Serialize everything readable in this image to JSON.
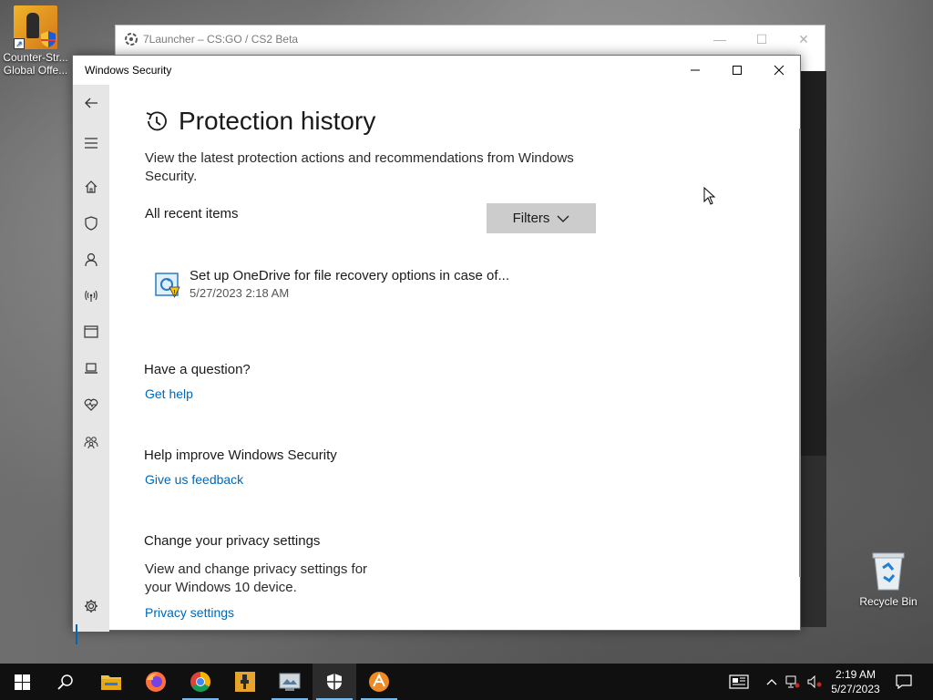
{
  "desktop": {
    "icons": [
      {
        "label": "Counter-Str... Global Offe..."
      },
      {
        "label": "Recycle Bin"
      }
    ]
  },
  "background_window": {
    "title": "7Launcher – CS:GO / CS2 Beta"
  },
  "window": {
    "title": "Windows Security",
    "controls": {
      "minimize": "minimize",
      "maximize": "maximize",
      "close": "close"
    }
  },
  "sidebar": {
    "items": [
      {
        "name": "back",
        "icon": "back-arrow-icon"
      },
      {
        "name": "menu",
        "icon": "hamburger-icon"
      },
      {
        "name": "home",
        "icon": "home-icon"
      },
      {
        "name": "virus-protection",
        "icon": "shield-icon"
      },
      {
        "name": "account-protection",
        "icon": "person-icon"
      },
      {
        "name": "firewall",
        "icon": "antenna-icon"
      },
      {
        "name": "app-browser-control",
        "icon": "browser-window-icon"
      },
      {
        "name": "device-security",
        "icon": "laptop-icon"
      },
      {
        "name": "device-performance",
        "icon": "heart-pulse-icon"
      },
      {
        "name": "family-options",
        "icon": "family-icon"
      },
      {
        "name": "settings",
        "icon": "gear-icon"
      }
    ]
  },
  "main": {
    "title": "Protection history",
    "description": "View the latest protection actions and recommendations from Windows Security.",
    "filter_label": "All recent items",
    "filters_button": "Filters",
    "history_items": [
      {
        "title": "Set up OneDrive for file recovery options in case of...",
        "timestamp": "5/27/2023 2:18 AM"
      }
    ],
    "question": {
      "heading": "Have a question?",
      "link": "Get help"
    },
    "improve": {
      "heading": "Help improve Windows Security",
      "link": "Give us feedback"
    },
    "privacy": {
      "heading": "Change your privacy settings",
      "text": "View and change privacy settings for your Windows 10 device.",
      "link": "Privacy settings"
    }
  },
  "taskbar": {
    "apps": [
      {
        "name": "start",
        "icon": "windows-logo-icon"
      },
      {
        "name": "search",
        "icon": "search-icon"
      },
      {
        "name": "file-explorer",
        "icon": "folder-icon"
      },
      {
        "name": "firefox",
        "icon": "firefox-icon"
      },
      {
        "name": "chrome",
        "icon": "chrome-icon"
      },
      {
        "name": "counter-strike",
        "icon": "csgo-icon"
      },
      {
        "name": "7launcher",
        "icon": "launcher-icon"
      },
      {
        "name": "windows-security",
        "icon": "shield-icon",
        "active": true
      },
      {
        "name": "app",
        "icon": "orange-app-icon"
      }
    ],
    "clock": {
      "time": "2:19 AM",
      "date": "5/27/2023"
    }
  },
  "colors": {
    "accent": "#0067b8",
    "sidebar_bg": "#e6e6e6",
    "taskbar_bg": "#101010",
    "filters_bg": "#cccccc"
  }
}
